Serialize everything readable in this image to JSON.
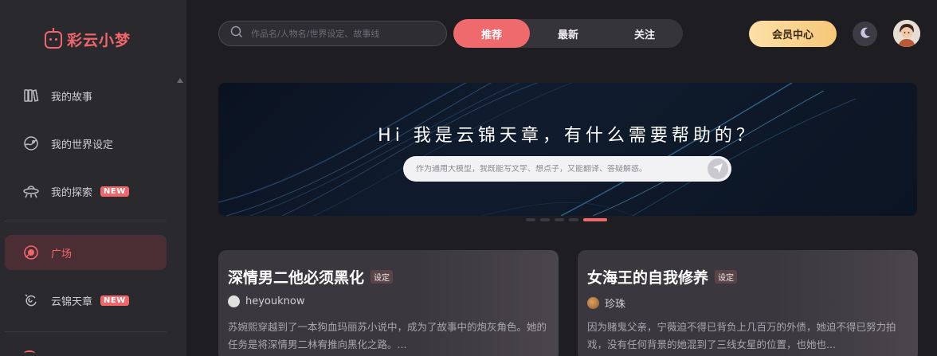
{
  "app": {
    "brand": "彩云小梦"
  },
  "sidebar": {
    "items": [
      {
        "label": "我的故事",
        "icon": "books-icon",
        "badge": ""
      },
      {
        "label": "我的世界设定",
        "icon": "globe-icon",
        "badge": ""
      },
      {
        "label": "我的探索",
        "icon": "ufo-icon",
        "badge": "NEW"
      },
      {
        "label": "广场",
        "icon": "plaza-icon",
        "badge": ""
      },
      {
        "label": "云锦天章",
        "icon": "spiral-icon",
        "badge": "NEW"
      }
    ],
    "active_index": 3
  },
  "search": {
    "placeholder": "作品名/人物名/世界设定、故事线"
  },
  "tabs": [
    {
      "label": "推荐",
      "active": true
    },
    {
      "label": "最新",
      "active": false
    },
    {
      "label": "关注",
      "active": false
    }
  ],
  "header": {
    "vip_label": "会员中心",
    "theme_icon": "moon-icon"
  },
  "banner": {
    "title": "Hi 我是云锦天章，有什么需要帮助的？",
    "input_placeholder": "作为通用大模型，我既能写文字、想点子，又能翻译、答疑解惑。",
    "send_icon": "send-icon"
  },
  "carousel": {
    "count": 5,
    "active": 4
  },
  "cards": [
    {
      "title": "深情男二他必须黑化",
      "tag": "设定",
      "author": "heyouknow",
      "description": "苏婉熙穿越到了一本狗血玛丽苏小说中，成为了故事中的炮灰角色。她的任务是将深情男二林宥推向黑化之路。..."
    },
    {
      "title": "女海王的自我修养",
      "tag": "设定",
      "author": "珍珠",
      "description": "因为赌鬼父亲，宁薇迫不得已背负上几百万的外债，她迫不得已努力拍戏，没有任何背景的她混到了三线女星的位置，也她也..."
    }
  ],
  "colors": {
    "accent": "#ee6a6c",
    "sidebar_bg": "#2a292e",
    "page_bg": "#1e1d22",
    "vip_gold": "#f6c778"
  }
}
